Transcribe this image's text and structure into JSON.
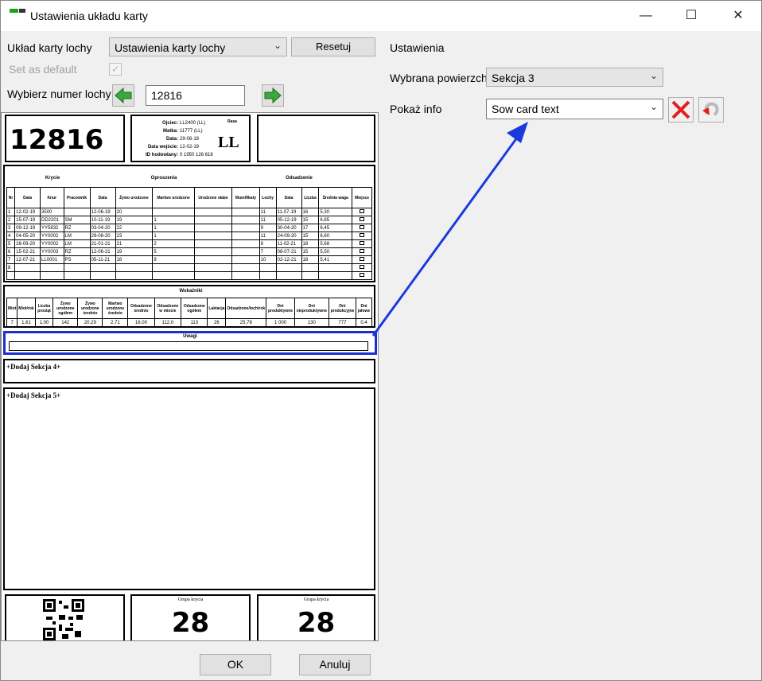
{
  "window": {
    "title": "Ustawienia układu karty",
    "minimize": "—",
    "maximize": "☐",
    "close": "✕"
  },
  "left": {
    "layout_label": "Układ karty lochy",
    "layout_value": "Ustawienia karty lochy",
    "reset_label": "Resetuj",
    "default_label": "Set as default",
    "sow_no_label": "Wybierz numer lochy",
    "sow_no_value": "12816"
  },
  "right": {
    "section_label": "Ustawienia",
    "surface_label": "Wybrana powierzchn",
    "surface_value": "Sekcja 3",
    "info_label": "Pokaż info",
    "info_value": "Sow card text"
  },
  "card": {
    "sow_number": "12816",
    "info": {
      "fields": [
        {
          "label": "Ojciec",
          "value": "LL2400 (LL)"
        },
        {
          "label": "Matka",
          "value": "11777 (LL)"
        },
        {
          "label": "Data",
          "value": "29-06-18"
        },
        {
          "label": "Data wejście",
          "value": "12-02-19"
        },
        {
          "label": "ID hodowlany",
          "value": "0 1950 126 618"
        }
      ],
      "race_label": "Rasa",
      "race_value": "LL"
    },
    "mating_title": "Krycie",
    "farrowing_title": "Oproszenia",
    "weaning_title": "Odsadzenie",
    "headers": [
      "Nr",
      "Data",
      "Knur",
      "Pracownik",
      "Data",
      "Żywo urodzone",
      "Martwo urodzone",
      "Urodzone słabe",
      "Mumifikaty",
      "Lochy",
      "Data",
      "Liczba",
      "Średnia waga",
      "Miejsce"
    ],
    "rows": [
      [
        "1",
        "12-02-19",
        "3500",
        "",
        "12-06-19",
        "20",
        "",
        "",
        "",
        "11",
        "11-07-19",
        "16",
        "5,30",
        ""
      ],
      [
        "2",
        "15-07-19",
        "DD2201",
        "SM",
        "10-11-19",
        "19",
        "1",
        "",
        "",
        "11",
        "05-12-19",
        "15",
        "6,85",
        ""
      ],
      [
        "3",
        "09-12-19",
        "YY5832",
        "RZ",
        "03-04-20",
        "22",
        "1",
        "",
        "",
        "9",
        "30-04-20",
        "17",
        "6,45",
        ""
      ],
      [
        "4",
        "04-05-20",
        "YY0002",
        "LM",
        "29-08-20",
        "23",
        "1",
        "",
        "",
        "11",
        "24-09-20",
        "15",
        "6,60",
        ""
      ],
      [
        "5",
        "28-09-20",
        "YY0002",
        "LM",
        "21-01-21",
        "21",
        "2",
        "",
        "",
        "8",
        "11-02-21",
        "18",
        "5,68",
        ""
      ],
      [
        "6",
        "15-02-21",
        "YY0003",
        "RZ",
        "12-06-21",
        "19",
        "5",
        "",
        "",
        "7",
        "08-07-21",
        "15",
        "5,50",
        ""
      ],
      [
        "7",
        "12-07-21",
        "LL0001",
        "PS",
        "05-11-21",
        "18",
        "9",
        "",
        "",
        "10",
        "02-12-21",
        "18",
        "5,41",
        ""
      ],
      [
        "8",
        "",
        "",
        "",
        "",
        "",
        "",
        "",
        "",
        "",
        "",
        "",
        "",
        ""
      ],
      [
        "",
        "",
        "",
        "",
        "",
        "",
        "",
        "",
        "",
        "",
        "",
        "",
        "",
        ""
      ]
    ],
    "results_title": "Wskaźniki",
    "results_headers": [
      "Miot",
      "Miot/rok",
      "Liczba prosiąt",
      "Żywo urodzone ogółem",
      "Żywo urodzone średnio",
      "Martwo urodzone średnio",
      "Odsadzone średnio",
      "Odsadzone w miocie",
      "Odsadzone ogółem",
      "Laktacja",
      "Odsadzone/loch/rok",
      "Dni produktywne",
      "Dni nieproduktywne",
      "Dni produkcyjne",
      "Dni jałowe"
    ],
    "results_values": [
      "7",
      "1,61",
      "1,00",
      "142",
      "20,29",
      "2,71",
      "16,00",
      "112,0",
      "113",
      "26",
      "25,78",
      "1 000",
      "130",
      "777",
      "0,4"
    ],
    "notes_title": "Uwagi",
    "section4": "+Dodaj Sekcja 4+",
    "section5": "+Dodaj Sekcja 5+",
    "group1_label": "Grupa krycia",
    "group1_value": "28",
    "group2_label": "Grupa krycia",
    "group2_value": "28"
  },
  "footer": {
    "ok": "OK",
    "cancel": "Anuluj"
  },
  "colors": {
    "arrow": "#1a3bdb",
    "highlight": "#1a2fd0",
    "green": "#2ea82e",
    "red": "#e02020"
  }
}
